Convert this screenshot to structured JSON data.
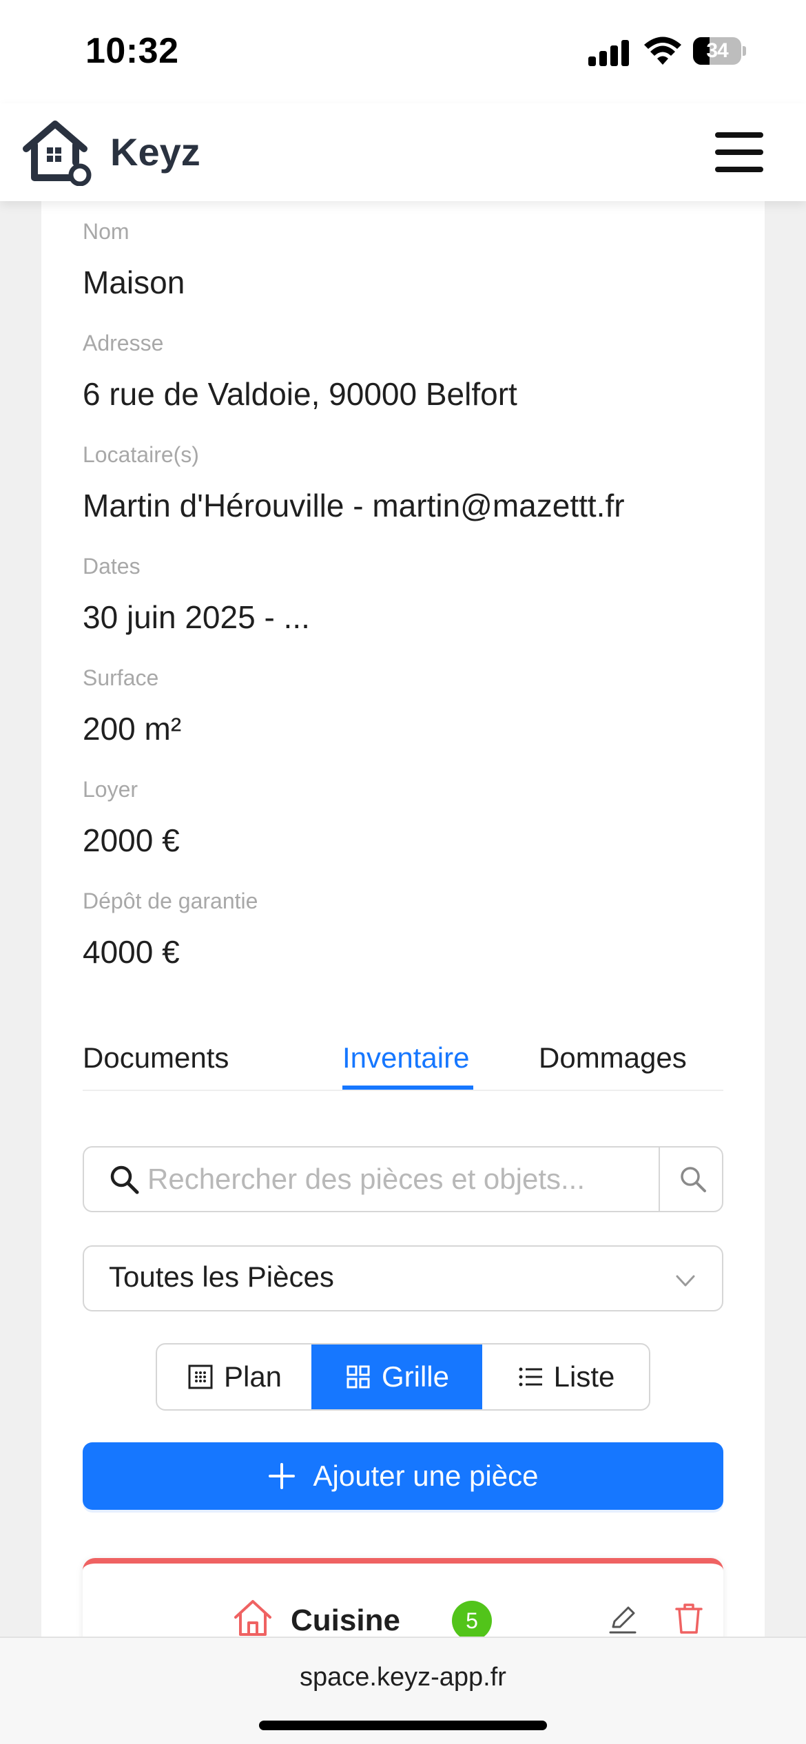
{
  "status_bar": {
    "time": "10:32",
    "battery_level": "34",
    "battery_fraction": 0.34
  },
  "header": {
    "brand": "Keyz",
    "logo_icon": "house-key-icon",
    "menu_icon": "hamburger-menu-icon"
  },
  "property": {
    "fields": [
      {
        "label": "Nom",
        "value": "Maison"
      },
      {
        "label": "Adresse",
        "value": "6 rue de Valdoie, 90000 Belfort"
      },
      {
        "label": "Locataire(s)",
        "value": "Martin d'Hérouville - martin@mazettt.fr"
      },
      {
        "label": "Dates",
        "value": "30 juin 2025 - ..."
      },
      {
        "label": "Surface",
        "value": "200 m²"
      },
      {
        "label": "Loyer",
        "value": "2000 €"
      },
      {
        "label": "Dépôt de garantie",
        "value": "4000 €"
      }
    ]
  },
  "tabs": [
    {
      "label": "Documents",
      "active": false
    },
    {
      "label": "Inventaire",
      "active": true
    },
    {
      "label": "Dommages",
      "active": false
    }
  ],
  "search": {
    "placeholder": "Rechercher des pièces et objets...",
    "value": ""
  },
  "room_filter": {
    "selected": "Toutes les Pièces"
  },
  "view_modes": [
    {
      "label": "Plan",
      "icon": "plan-icon",
      "active": false
    },
    {
      "label": "Grille",
      "icon": "grid-icon",
      "active": true
    },
    {
      "label": "Liste",
      "icon": "list-icon",
      "active": false
    }
  ],
  "add_room_button": {
    "label": "Ajouter une pièce"
  },
  "rooms": [
    {
      "name": "Cuisine",
      "count": "5",
      "icon": "home-icon",
      "accent": "#ef6262"
    }
  ],
  "browser": {
    "url": "space.keyz-app.fr"
  },
  "colors": {
    "primary": "#1677ff",
    "success": "#52c41a",
    "danger": "#ef6262"
  }
}
